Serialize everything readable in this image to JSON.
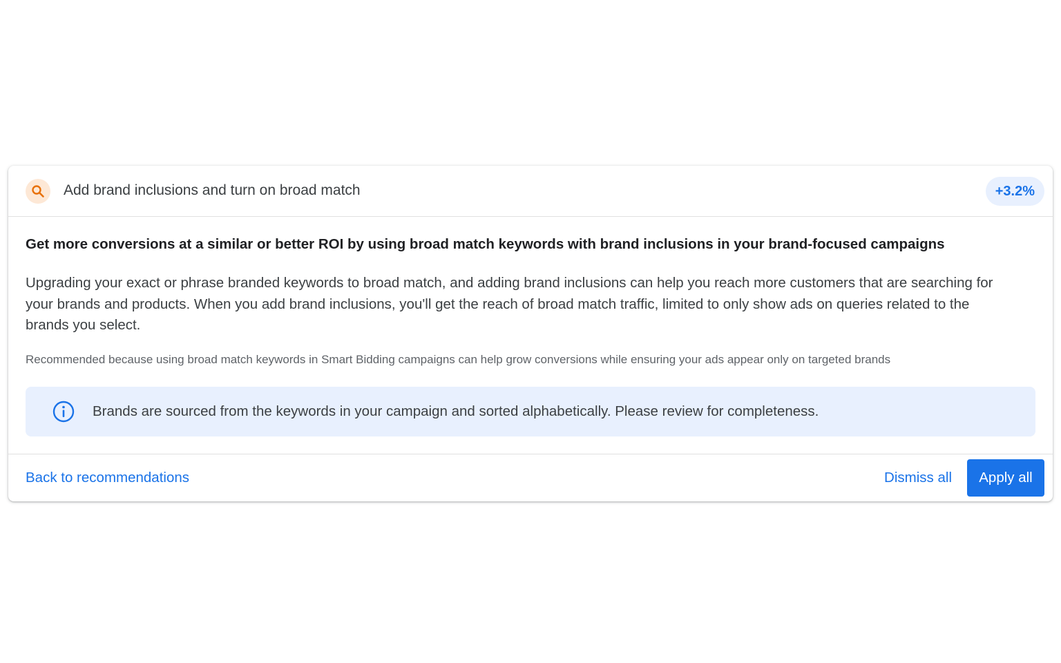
{
  "recommendation": {
    "icon": "search-icon",
    "title": "Add brand inclusions and turn on broad match",
    "uplift": "+3.2%",
    "headline": "Get more conversions at a similar or better ROI by using broad match keywords with brand inclusions in your brand-focused campaigns",
    "description": "Upgrading your exact or phrase branded keywords to broad match, and adding brand inclusions can help you reach more customers that are searching for your brands and products. When you add brand inclusions, you'll get the reach of broad match traffic, limited to only show ads on queries related to the brands you select.",
    "reason": "Recommended because using broad match keywords in Smart Bidding campaigns can help grow conversions while ensuring your ads appear only on targeted brands"
  },
  "info": {
    "icon": "info-icon",
    "text": "Brands are sourced from the keywords in your campaign and sorted alphabetically. Please review for completeness."
  },
  "footer": {
    "back_label": "Back to recommendations",
    "dismiss_label": "Dismiss all",
    "apply_label": "Apply all"
  },
  "colors": {
    "accent": "#1a73e8",
    "icon_bg": "#fde8d6",
    "icon_fg": "#e8710a",
    "info_bg": "#e8f0fe"
  }
}
